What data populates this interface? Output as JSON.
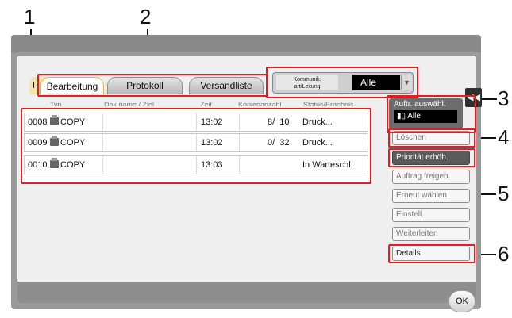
{
  "callouts": [
    "1",
    "2",
    "3",
    "4",
    "5",
    "6"
  ],
  "tabs": {
    "partial_left": "I",
    "items": [
      {
        "label": "Bearbeitung",
        "active": true
      },
      {
        "label": "Protokoll",
        "active": false
      },
      {
        "label": "Versandliste",
        "active": false
      }
    ]
  },
  "comm": {
    "label": "Kommunik.\nart/Leitung",
    "value": "Alle"
  },
  "columns": [
    "Typ",
    "Dok.name / Ziel",
    "Zeit",
    "Kopienanzahl",
    "Status/Ergebnis"
  ],
  "jobs": [
    {
      "id": "0008",
      "type": "COPY",
      "name": "",
      "time": "13:02",
      "copies": "8/  10",
      "status": "Druck..."
    },
    {
      "id": "0009",
      "type": "COPY",
      "name": "",
      "time": "13:02",
      "copies": "0/  32",
      "status": "Druck..."
    },
    {
      "id": "0010",
      "type": "COPY",
      "name": "",
      "time": "13:03",
      "copies": "",
      "status": "In Warteschl."
    }
  ],
  "side": {
    "select_label": "Auftr. auswähl.",
    "select_value": "Alle",
    "buttons": [
      "Löschen",
      "Priorität erhöh.",
      "Auftrag freigeb.",
      "Erneut wählen",
      "Einstell.",
      "Weiterleiten",
      "Details"
    ]
  },
  "ok": "OK",
  "colors": {
    "highlight": "#e41d22",
    "panel": "#9a9a9a",
    "active_tab_border": "#e0b64a"
  },
  "icons": {
    "collapse": "double-chevron-left-icon",
    "job_type": "copy-icon",
    "select": "chevron-down-icon"
  }
}
